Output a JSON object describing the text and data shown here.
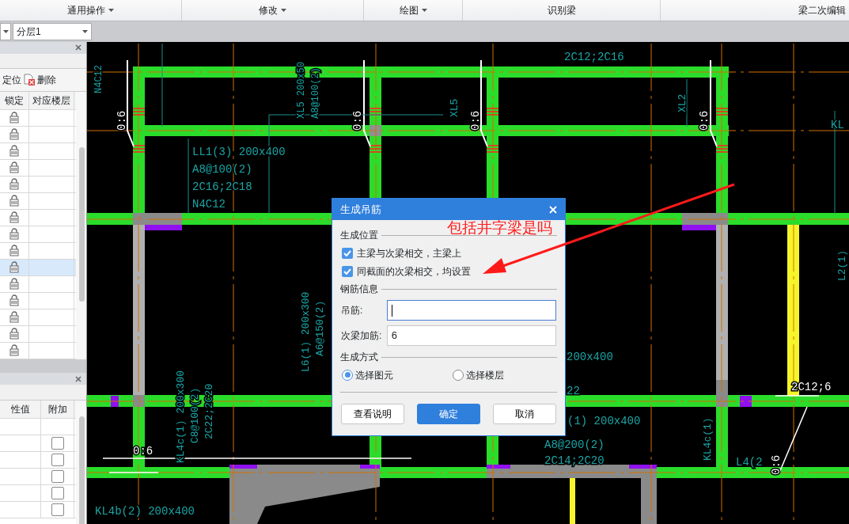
{
  "toolbar": [
    {
      "label": "通用操作",
      "dropdown": true
    },
    {
      "label": "修改",
      "dropdown": true
    },
    {
      "label": "绘图",
      "dropdown": true
    },
    {
      "label": "识别梁",
      "dropdown": false
    },
    {
      "label": "梁二次编辑",
      "dropdown": false
    }
  ],
  "layer_select": {
    "value": "分层1"
  },
  "layer_panel": {
    "actions": [
      {
        "label": "定位",
        "kind": "plain"
      },
      {
        "label": "删除",
        "kind": "delete"
      }
    ],
    "columns": [
      "锁定",
      "对应楼层"
    ],
    "rows": [
      {
        "selected": false
      },
      {
        "selected": false
      },
      {
        "selected": false
      },
      {
        "selected": false
      },
      {
        "selected": false
      },
      {
        "selected": false
      },
      {
        "selected": false
      },
      {
        "selected": false
      },
      {
        "selected": false
      },
      {
        "selected": true
      },
      {
        "selected": false
      },
      {
        "selected": false
      },
      {
        "selected": false
      },
      {
        "selected": false
      },
      {
        "selected": false
      }
    ]
  },
  "property_panel": {
    "columns": [
      "性值",
      "附加"
    ],
    "rows": [
      {
        "kind": "blank"
      },
      {
        "kind": "checkbox",
        "checked": false
      },
      {
        "kind": "checkbox",
        "checked": false
      },
      {
        "kind": "checkbox",
        "checked": false
      },
      {
        "kind": "checkbox",
        "checked": false
      },
      {
        "kind": "checkbox",
        "checked": false
      }
    ]
  },
  "drawing": {
    "labels": [
      {
        "text": "N4C12"
      },
      {
        "text": "LL1(3) 200x400"
      },
      {
        "text": "A8@100(2)"
      },
      {
        "text": "2C16;2C18"
      },
      {
        "text": "N4C12"
      },
      {
        "text": "XL5 200x50"
      },
      {
        "text": "A8@100(2)"
      },
      {
        "text": "XL5"
      },
      {
        "text": "2C12;2C16"
      },
      {
        "text": "XL2"
      },
      {
        "text": "0:6"
      },
      {
        "text": "0:6"
      },
      {
        "text": "0:6"
      },
      {
        "text": "0:6"
      },
      {
        "text": "L6(1) 200x300"
      },
      {
        "text": "A6@150(2)"
      },
      {
        "text": "KL4c(1) 200x300"
      },
      {
        "text": "C8@100(2)"
      },
      {
        "text": "2C22;2C20"
      },
      {
        "text": "200x400"
      },
      {
        "text": "22"
      },
      {
        "text": "(1) 200x400"
      },
      {
        "text": "A8@200(2)"
      },
      {
        "text": "2C14;2C20"
      },
      {
        "text": "KL4c(1)"
      },
      {
        "text": "L4(2"
      },
      {
        "text": "0:6"
      },
      {
        "text": "0:6"
      },
      {
        "text": "2C12;6"
      },
      {
        "text": "L2(1)"
      },
      {
        "text": "KL4b(2) 200x400"
      },
      {
        "text": "KL"
      }
    ]
  },
  "dialog": {
    "title": "生成吊筋",
    "sections": [
      {
        "title": "生成位置",
        "kind": "checkboxes",
        "options": [
          {
            "label": "主梁与次梁相交，主梁上",
            "checked": true
          },
          {
            "label": "同截面的次梁相交，均设置",
            "checked": true
          }
        ]
      },
      {
        "title": "钢筋信息",
        "kind": "fields",
        "fields": [
          {
            "label": "吊筋:",
            "focused": true
          },
          {
            "label": "次梁加筋:",
            "value": "6",
            "focused": false
          }
        ]
      },
      {
        "title": "生成方式",
        "kind": "radios",
        "options": [
          {
            "label": "选择图元",
            "selected": true
          },
          {
            "label": "选择楼层",
            "selected": false
          }
        ]
      }
    ],
    "buttons": [
      {
        "label": "查看说明",
        "primary": false
      },
      {
        "label": "确定",
        "primary": true
      },
      {
        "label": "取消",
        "primary": false
      }
    ]
  },
  "annotation": {
    "text": "包括井字梁是吗"
  }
}
